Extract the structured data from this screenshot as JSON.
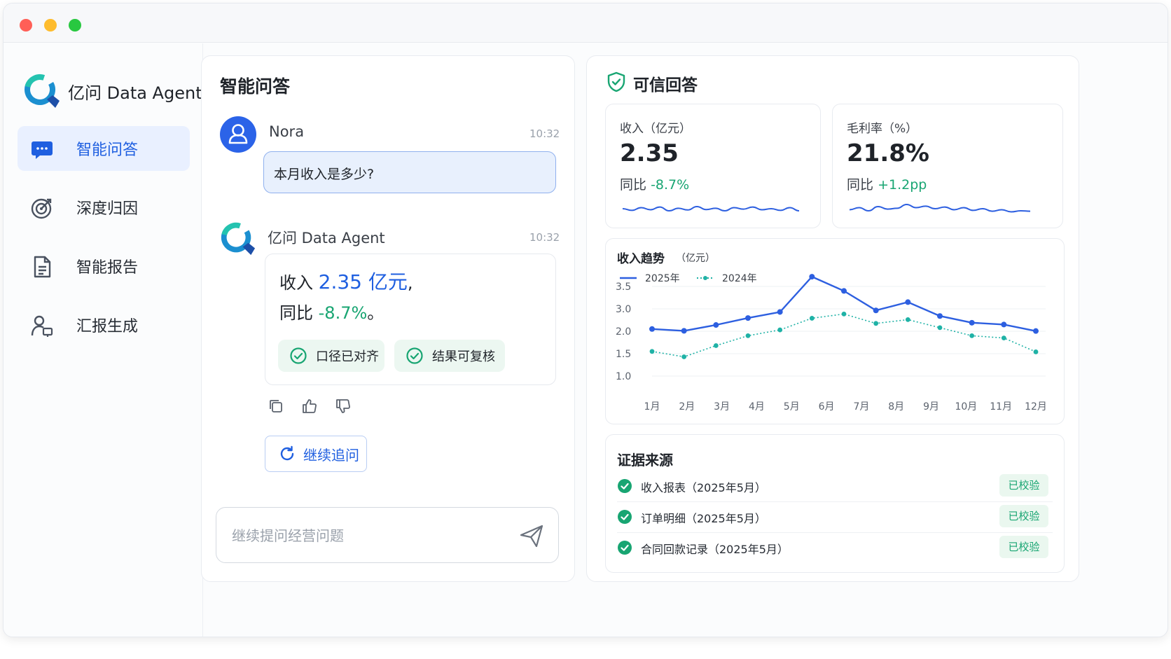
{
  "window": {
    "title_dots": [
      "close",
      "minimize",
      "maximize"
    ]
  },
  "brand": {
    "name": "亿问 Data Agent"
  },
  "sidebar": {
    "items": [
      {
        "label": "智能问答",
        "icon": "chat-bubble-icon",
        "active": true
      },
      {
        "label": "深度归因",
        "icon": "target-icon",
        "active": false
      },
      {
        "label": "智能报告",
        "icon": "document-icon",
        "active": false
      },
      {
        "label": "汇报生成",
        "icon": "presenter-icon",
        "active": false
      }
    ]
  },
  "chat": {
    "title": "智能问答",
    "user_message": {
      "name": "Nora",
      "time": "10:32",
      "text": "本月收入是多少?"
    },
    "agent_message": {
      "name": "亿问 Data Agent",
      "time": "10:32",
      "line1_prefix": "收入 ",
      "line1_value": "2.35 亿元",
      "line1_suffix": ",",
      "line2_prefix": "同比 ",
      "line2_value": "-8.7%",
      "line2_suffix": "。",
      "chips": [
        "口径已对齐",
        "结果可复核"
      ]
    },
    "actions": [
      "copy-icon",
      "thumbs-up-icon",
      "thumbs-down-icon"
    ],
    "followup_label": "继续追问",
    "input_placeholder": "继续提问经营问题"
  },
  "trusted": {
    "title": "可信回答",
    "kpis": [
      {
        "label": "收入（亿元）",
        "value": "2.35",
        "yoy_label": "同比",
        "yoy_value": "-8.7%"
      },
      {
        "label": "毛利率（%）",
        "value": "21.8%",
        "yoy_label": "同比",
        "yoy_value": "+1.2pp"
      }
    ],
    "trend": {
      "title": "收入趋势",
      "unit": "（亿元）"
    },
    "evidence": {
      "title": "证据来源",
      "items": [
        {
          "label": "收入报表（2025年5月）",
          "status": "已校验"
        },
        {
          "label": "订单明细（2025年5月）",
          "status": "已校验"
        },
        {
          "label": "合同回款记录（2025年5月）",
          "status": "已校验"
        }
      ]
    }
  },
  "colors": {
    "accent": "#1f5fe0",
    "positive": "#18a572",
    "series_2025": "#2d5fe0",
    "series_2024": "#1fb2a6",
    "active_nav_bg": "#e9f0ff"
  },
  "chart_data": {
    "type": "line",
    "title": "收入趋势",
    "ylabel": "（亿元）",
    "xlabel": "",
    "categories": [
      "1月",
      "2月",
      "3月",
      "4月",
      "5月",
      "6月",
      "7月",
      "8月",
      "9月",
      "10月",
      "11月",
      "12月"
    ],
    "y_ticks": [
      "3.5",
      "3.0",
      "2.0",
      "1.5",
      "1.0"
    ],
    "grid": true,
    "legend": "top-left",
    "series": [
      {
        "name": "2025年",
        "style": "solid",
        "values": [
          2.1,
          2.02,
          2.28,
          2.59,
          2.86,
          3.72,
          3.4,
          2.93,
          3.15,
          2.68,
          2.38,
          2.3,
          2.01
        ]
      },
      {
        "name": "2024年",
        "style": "dotted",
        "values": [
          1.55,
          1.43,
          1.68,
          1.9,
          2.06,
          2.58,
          2.77,
          2.35,
          2.52,
          2.16,
          1.9,
          1.85,
          1.54
        ]
      }
    ],
    "sparklines": {
      "revenue": [
        0.5,
        0.42,
        0.55,
        0.45,
        0.58,
        0.4,
        0.52,
        0.44,
        0.6,
        0.46,
        0.52,
        0.4,
        0.55,
        0.48,
        0.58,
        0.45,
        0.5,
        0.42,
        0.55,
        0.4
      ],
      "gross_margin": [
        0.45,
        0.55,
        0.4,
        0.6,
        0.48,
        0.52,
        0.7,
        0.55,
        0.62,
        0.5,
        0.58,
        0.45,
        0.55,
        0.42,
        0.5,
        0.38,
        0.45,
        0.35,
        0.4,
        0.38
      ]
    }
  }
}
